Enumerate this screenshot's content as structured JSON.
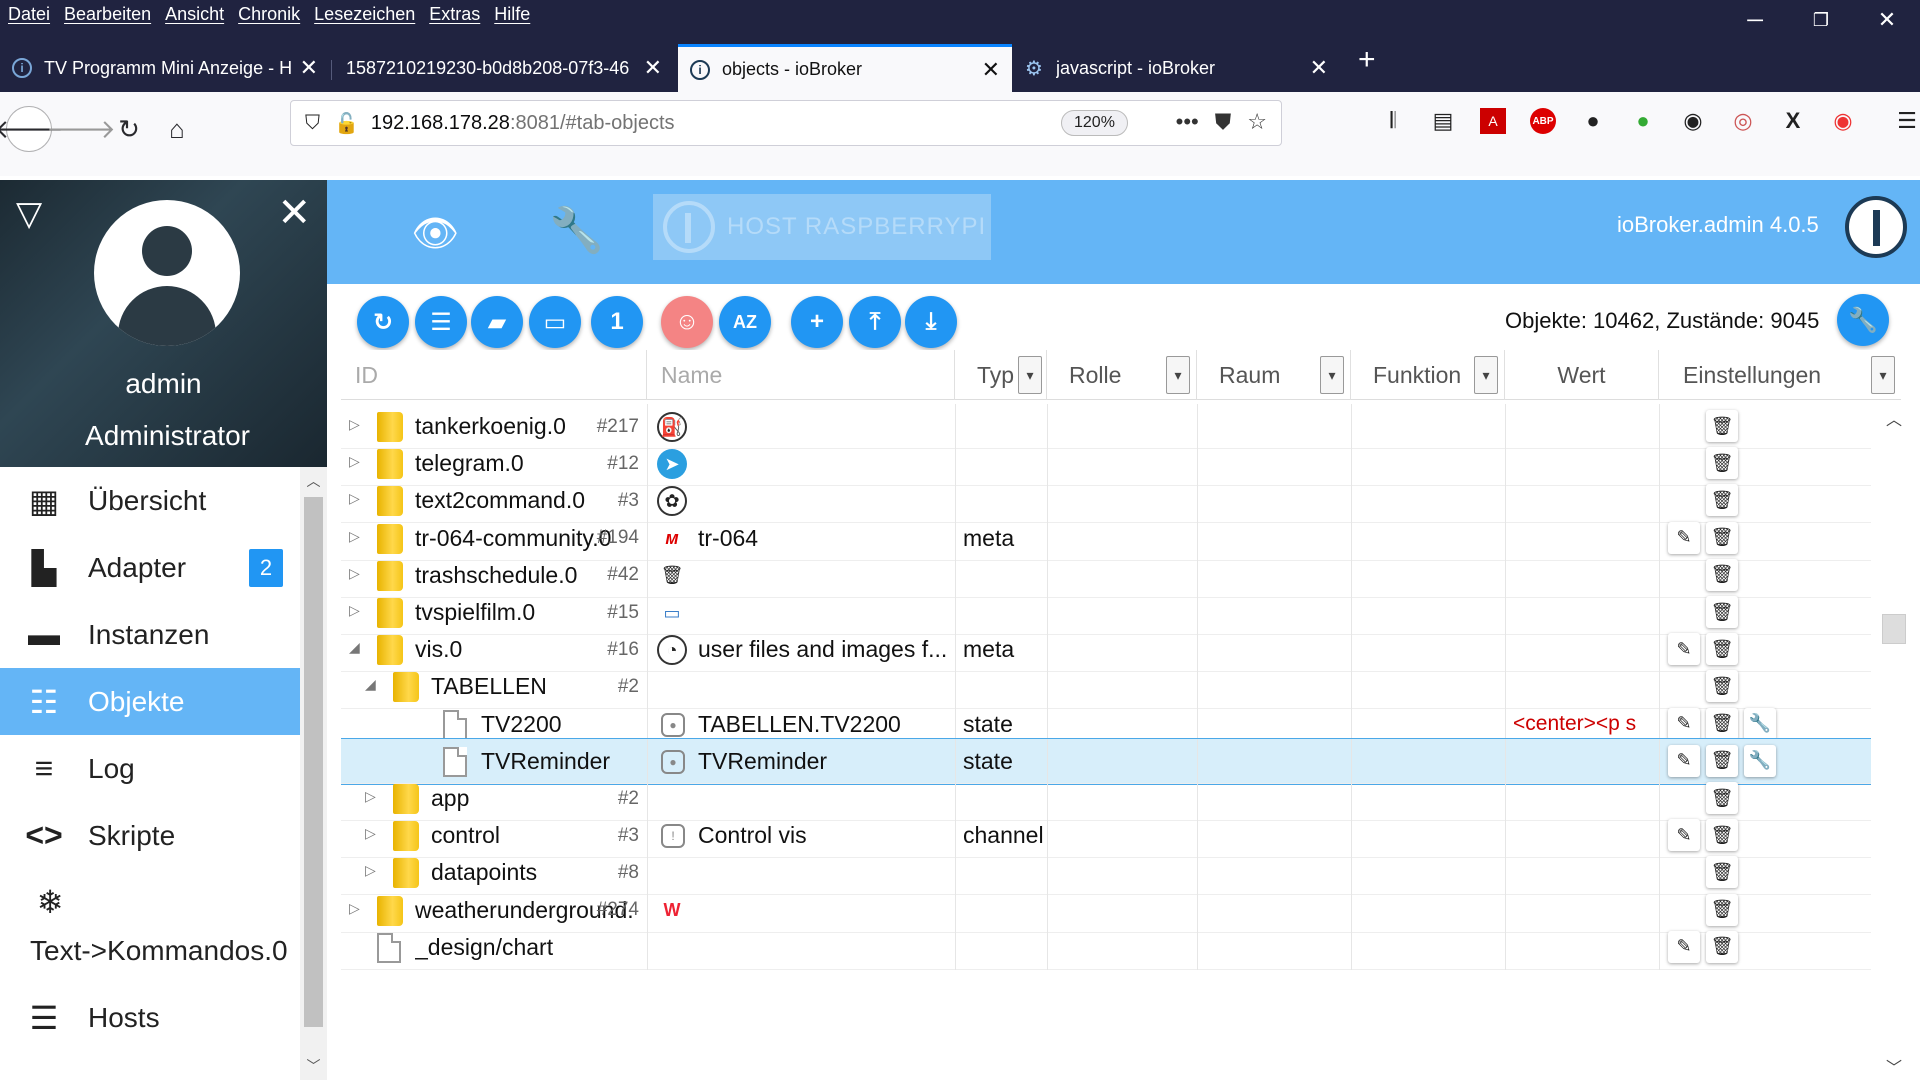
{
  "browser": {
    "menu": [
      "Datei",
      "Bearbeiten",
      "Ansicht",
      "Chronik",
      "Lesezeichen",
      "Extras",
      "Hilfe"
    ],
    "window_controls": [
      "─",
      "❐",
      "✕"
    ],
    "tabs": [
      {
        "title": "TV Programm Mini Anzeige - H",
        "active": false
      },
      {
        "title": "1587210219230-b0d8b208-07f3-46",
        "active": false
      },
      {
        "title": "objects - ioBroker",
        "active": true
      },
      {
        "title": "javascript - ioBroker",
        "active": false
      }
    ],
    "url_host": "192.168.178.28",
    "url_path": ":8081/#tab-objects",
    "zoom": "120%"
  },
  "sidebar": {
    "user": "admin",
    "role": "Administrator",
    "items": [
      {
        "label": "Übersicht",
        "icon": "grid-icon",
        "active": false
      },
      {
        "label": "Adapter",
        "icon": "store-icon",
        "active": false,
        "badge": "2"
      },
      {
        "label": "Instanzen",
        "icon": "instances-icon",
        "active": false
      },
      {
        "label": "Objekte",
        "icon": "list-icon",
        "active": true
      },
      {
        "label": "Log",
        "icon": "log-icon",
        "active": false
      },
      {
        "label": "Skripte",
        "icon": "code-icon",
        "active": false
      },
      {
        "label": "Text->Kommandos.0",
        "icon": "snowflake-icon",
        "active": false
      },
      {
        "label": "Hosts",
        "icon": "hosts-icon",
        "active": false
      }
    ]
  },
  "header": {
    "host": "HOST RASPBERRYPI",
    "version": "ioBroker.admin 4.0.5"
  },
  "toolbar": {
    "counts": "Objekte: 10462, Zustände: 9045"
  },
  "table": {
    "columns": {
      "id": "ID",
      "name": "Name",
      "type": "Typ",
      "role": "Rolle",
      "room": "Raum",
      "function": "Funktion",
      "value": "Wert",
      "settings": "Einstellungen"
    },
    "rows": [
      {
        "id": "tankerkoenig.0",
        "count": "#217",
        "name": "",
        "type": "",
        "value": "",
        "level": 0,
        "expander": "▷",
        "kind": "folder",
        "icon": "fuel-icon",
        "edit": false,
        "wrench": false
      },
      {
        "id": "telegram.0",
        "count": "#12",
        "name": "",
        "type": "",
        "value": "",
        "level": 0,
        "expander": "▷",
        "kind": "folder",
        "icon": "telegram-icon",
        "edit": false,
        "wrench": false
      },
      {
        "id": "text2command.0",
        "count": "#3",
        "name": "",
        "type": "",
        "value": "",
        "level": 0,
        "expander": "▷",
        "kind": "folder",
        "icon": "brain-icon",
        "edit": false,
        "wrench": false
      },
      {
        "id": "tr-064-community.0",
        "count": "#194",
        "name": "tr-064",
        "type": "meta",
        "value": "",
        "level": 0,
        "expander": "▷",
        "kind": "folder",
        "icon": "avm-icon",
        "edit": true,
        "wrench": false
      },
      {
        "id": "trashschedule.0",
        "count": "#42",
        "name": "",
        "type": "",
        "value": "",
        "level": 0,
        "expander": "▷",
        "kind": "folder",
        "icon": "trash-can-icon",
        "edit": false,
        "wrench": false
      },
      {
        "id": "tvspielfilm.0",
        "count": "#15",
        "name": "",
        "type": "",
        "value": "",
        "level": 0,
        "expander": "▷",
        "kind": "folder",
        "icon": "tv-icon",
        "edit": false,
        "wrench": false
      },
      {
        "id": "vis.0",
        "count": "#16",
        "name": "user files and images f...",
        "type": "meta",
        "value": "",
        "level": 0,
        "expander": "◢",
        "kind": "folder",
        "icon": "vis-icon",
        "edit": true,
        "wrench": false
      },
      {
        "id": "TABELLEN",
        "count": "#2",
        "name": "",
        "type": "",
        "value": "",
        "level": 1,
        "expander": "◢",
        "kind": "folder",
        "icon": "",
        "edit": false,
        "wrench": false
      },
      {
        "id": "TV2200",
        "count": "",
        "name": "TABELLEN.TV2200",
        "type": "state",
        "value": "<center><p s",
        "level": 2,
        "expander": "",
        "kind": "file",
        "icon": "state-icon",
        "edit": true,
        "wrench": true
      },
      {
        "id": "TVReminder",
        "count": "",
        "name": "TVReminder",
        "type": "state",
        "value": "",
        "level": 2,
        "expander": "",
        "kind": "file",
        "icon": "state-icon",
        "edit": true,
        "wrench": true,
        "selected": true
      },
      {
        "id": "app",
        "count": "#2",
        "name": "",
        "type": "",
        "value": "",
        "level": 1,
        "expander": "▷",
        "kind": "folder",
        "icon": "",
        "edit": false,
        "wrench": false
      },
      {
        "id": "control",
        "count": "#3",
        "name": "Control vis",
        "type": "channel",
        "value": "",
        "level": 1,
        "expander": "▷",
        "kind": "folder",
        "icon": "channel-icon",
        "edit": true,
        "wrench": false
      },
      {
        "id": "datapoints",
        "count": "#8",
        "name": "",
        "type": "",
        "value": "",
        "level": 1,
        "expander": "▷",
        "kind": "folder",
        "icon": "",
        "edit": false,
        "wrench": false
      },
      {
        "id": "weatherunderground.",
        "count": "#274",
        "name": "",
        "type": "",
        "value": "",
        "level": 0,
        "expander": "▷",
        "kind": "folder",
        "icon": "wu-icon",
        "edit": false,
        "wrench": false
      },
      {
        "id": "_design/chart",
        "count": "",
        "name": "",
        "type": "",
        "value": "",
        "level": 0,
        "expander": "",
        "kind": "file",
        "icon": "",
        "edit": true,
        "wrench": false
      }
    ]
  },
  "colors": {
    "accent": "#64b5f6",
    "button": "#2196f3",
    "chrome": "#202340",
    "selected_row": "#d7eefa",
    "value_red": "#cc0000"
  }
}
